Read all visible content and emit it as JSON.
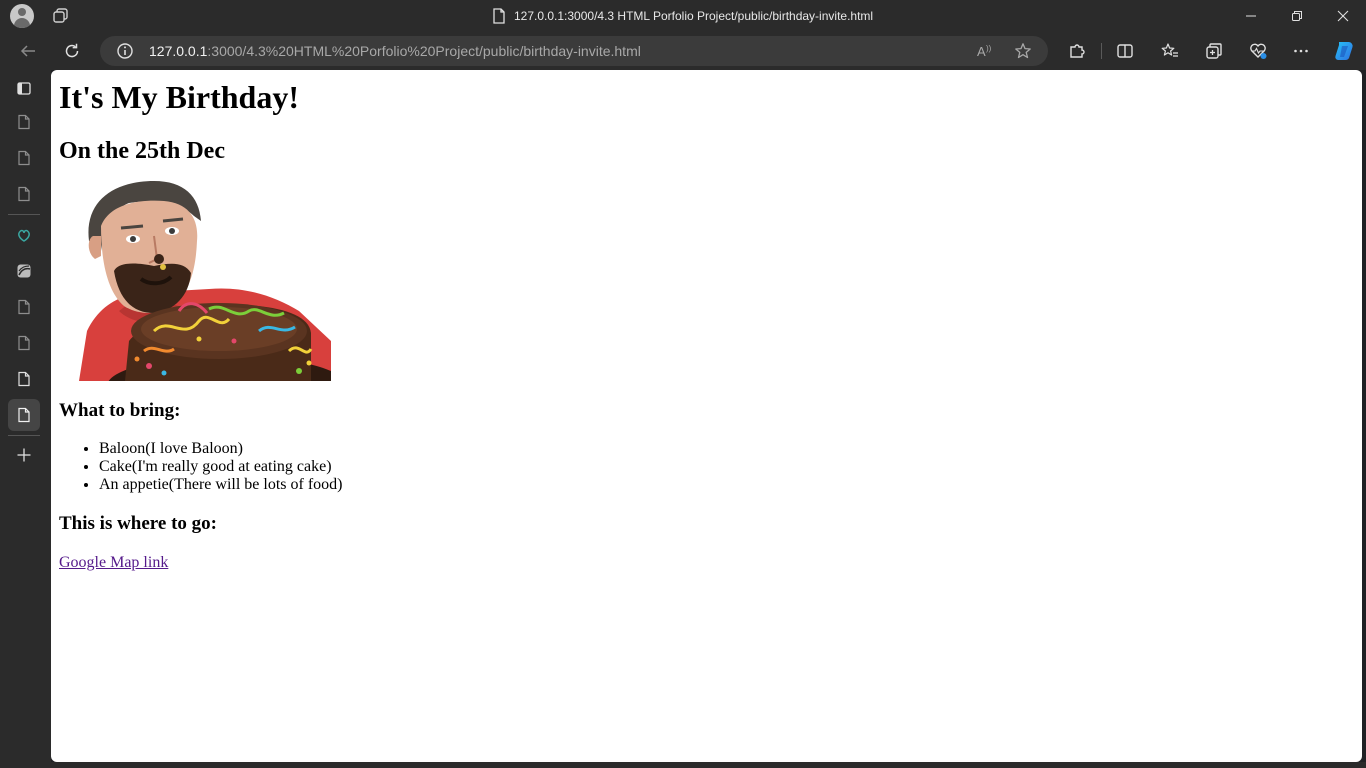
{
  "window": {
    "title": "127.0.0.1:3000/4.3 HTML Porfolio Project/public/birthday-invite.html"
  },
  "address_bar": {
    "host": "127.0.0.1",
    "path": ":3000/4.3%20HTML%20Porfolio%20Project/public/birthday-invite.html"
  },
  "page": {
    "heading": "It's My Birthday!",
    "date_heading": "On the 25th Dec",
    "bring_heading": "What to bring:",
    "bring_items": [
      "Baloon(I love Baloon)",
      "Cake(I'm really good at eating cake)",
      "An appetie(There will be lots of food)"
    ],
    "where_heading": "This is where to go:",
    "map_link": "Google Map link"
  },
  "colors": {
    "chrome": "#2b2b2b",
    "address_bg": "#3b3b3b",
    "visited_link": "#551a8b"
  }
}
